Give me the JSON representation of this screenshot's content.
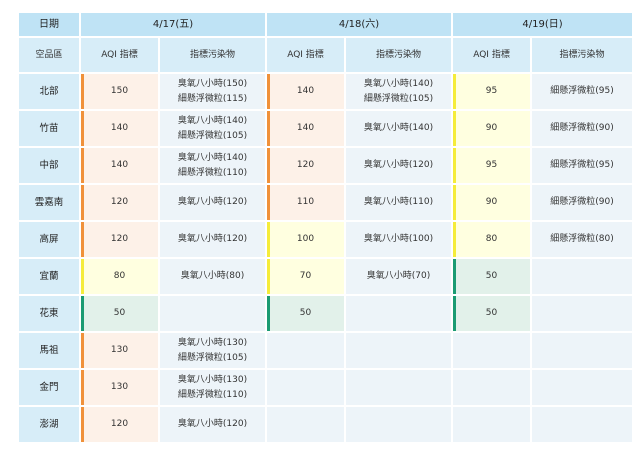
{
  "header": {
    "date_label": "日期",
    "area_label": "空品區",
    "aqi_label": "AQI 指標",
    "pollutant_label": "指標污染物",
    "days": [
      "4/17(五)",
      "4/18(六)",
      "4/19(日)"
    ]
  },
  "levels": {
    "orange": "#f0913a",
    "yellow": "#f5ec3a",
    "green": "#1b9b72"
  },
  "rows": [
    {
      "region": "北部",
      "days": [
        {
          "aqi": "150",
          "level": "orange",
          "pollutants": [
            "臭氧八小時(150)",
            "細懸浮微粒(115)"
          ]
        },
        {
          "aqi": "140",
          "level": "orange",
          "pollutants": [
            "臭氧八小時(140)",
            "細懸浮微粒(105)"
          ]
        },
        {
          "aqi": "95",
          "level": "yellow",
          "pollutants": [
            "細懸浮微粒(95)"
          ]
        }
      ]
    },
    {
      "region": "竹苗",
      "days": [
        {
          "aqi": "140",
          "level": "orange",
          "pollutants": [
            "臭氧八小時(140)",
            "細懸浮微粒(105)"
          ]
        },
        {
          "aqi": "140",
          "level": "orange",
          "pollutants": [
            "臭氧八小時(140)"
          ]
        },
        {
          "aqi": "90",
          "level": "yellow",
          "pollutants": [
            "細懸浮微粒(90)"
          ]
        }
      ]
    },
    {
      "region": "中部",
      "days": [
        {
          "aqi": "140",
          "level": "orange",
          "pollutants": [
            "臭氧八小時(140)",
            "細懸浮微粒(110)"
          ]
        },
        {
          "aqi": "120",
          "level": "orange",
          "pollutants": [
            "臭氧八小時(120)"
          ]
        },
        {
          "aqi": "95",
          "level": "yellow",
          "pollutants": [
            "細懸浮微粒(95)"
          ]
        }
      ]
    },
    {
      "region": "雲嘉南",
      "days": [
        {
          "aqi": "120",
          "level": "orange",
          "pollutants": [
            "臭氧八小時(120)"
          ]
        },
        {
          "aqi": "110",
          "level": "orange",
          "pollutants": [
            "臭氧八小時(110)"
          ]
        },
        {
          "aqi": "90",
          "level": "yellow",
          "pollutants": [
            "細懸浮微粒(90)"
          ]
        }
      ]
    },
    {
      "region": "高屏",
      "days": [
        {
          "aqi": "120",
          "level": "orange",
          "pollutants": [
            "臭氧八小時(120)"
          ]
        },
        {
          "aqi": "100",
          "level": "yellow",
          "pollutants": [
            "臭氧八小時(100)"
          ]
        },
        {
          "aqi": "80",
          "level": "yellow",
          "pollutants": [
            "細懸浮微粒(80)"
          ]
        }
      ]
    },
    {
      "region": "宜蘭",
      "days": [
        {
          "aqi": "80",
          "level": "yellow",
          "pollutants": [
            "臭氧八小時(80)"
          ]
        },
        {
          "aqi": "70",
          "level": "yellow",
          "pollutants": [
            "臭氧八小時(70)"
          ]
        },
        {
          "aqi": "50",
          "level": "green",
          "pollutants": []
        }
      ]
    },
    {
      "region": "花東",
      "days": [
        {
          "aqi": "50",
          "level": "green",
          "pollutants": []
        },
        {
          "aqi": "50",
          "level": "green",
          "pollutants": []
        },
        {
          "aqi": "50",
          "level": "green",
          "pollutants": []
        }
      ]
    },
    {
      "region": "馬祖",
      "days": [
        {
          "aqi": "130",
          "level": "orange",
          "pollutants": [
            "臭氧八小時(130)",
            "細懸浮微粒(105)"
          ]
        },
        {
          "aqi": "",
          "level": "none",
          "pollutants": []
        },
        {
          "aqi": "",
          "level": "none",
          "pollutants": []
        }
      ]
    },
    {
      "region": "金門",
      "days": [
        {
          "aqi": "130",
          "level": "orange",
          "pollutants": [
            "臭氧八小時(130)",
            "細懸浮微粒(110)"
          ]
        },
        {
          "aqi": "",
          "level": "none",
          "pollutants": []
        },
        {
          "aqi": "",
          "level": "none",
          "pollutants": []
        }
      ]
    },
    {
      "region": "澎湖",
      "days": [
        {
          "aqi": "120",
          "level": "orange",
          "pollutants": [
            "臭氧八小時(120)"
          ]
        },
        {
          "aqi": "",
          "level": "none",
          "pollutants": []
        },
        {
          "aqi": "",
          "level": "none",
          "pollutants": []
        }
      ]
    }
  ]
}
